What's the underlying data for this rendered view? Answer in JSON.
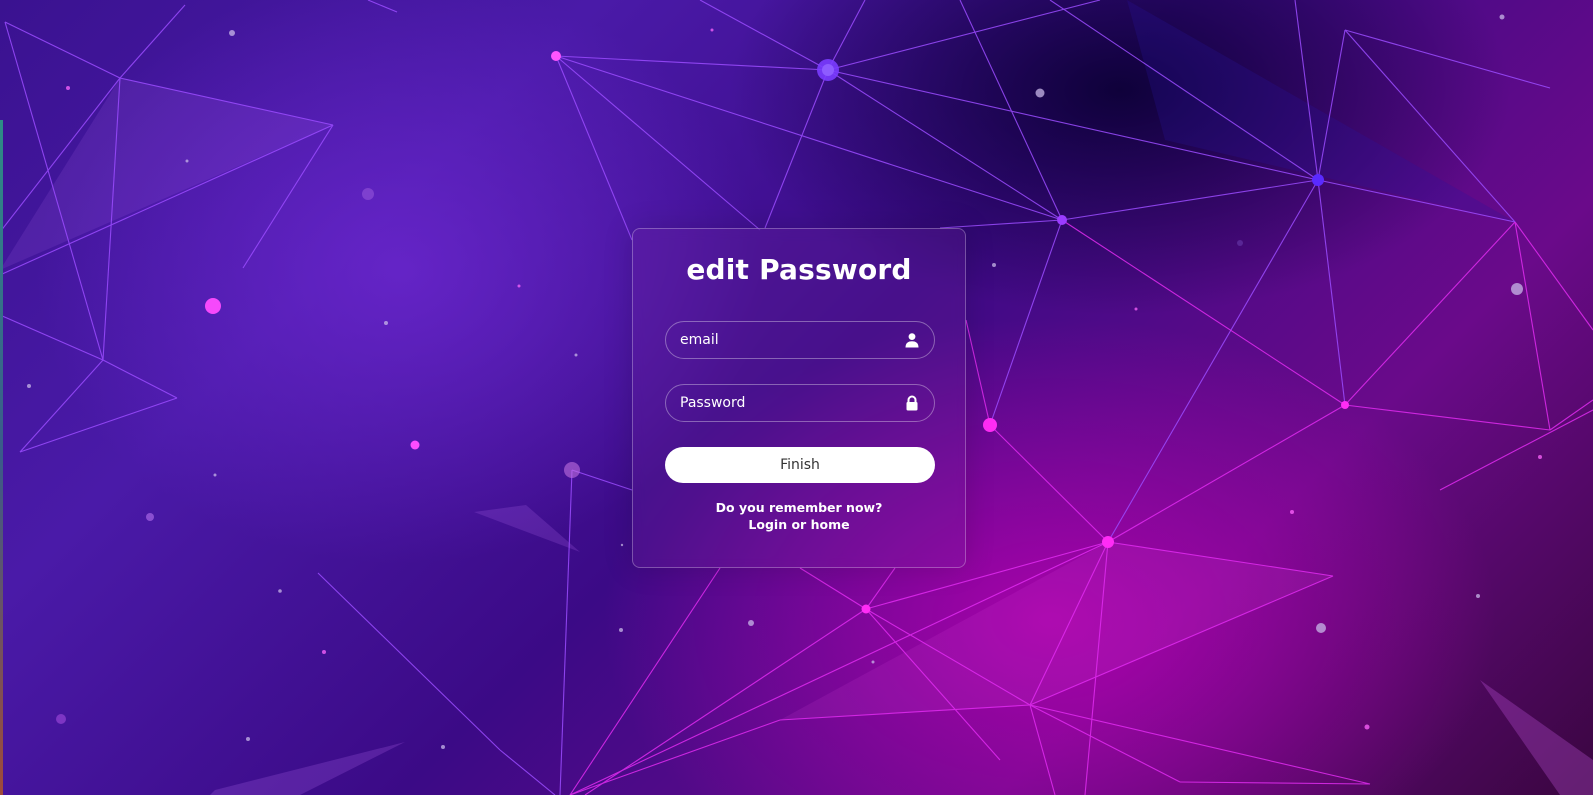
{
  "form": {
    "title": "edit Password",
    "email_placeholder": "email",
    "password_placeholder": "Password",
    "submit_label": "Finish",
    "remember_text": "Do you remember now?",
    "login_link": "Login",
    "or_text": "or",
    "home_link": "home"
  },
  "icons": {
    "email": "user-icon",
    "password": "lock-icon"
  },
  "colors": {
    "button_bg": "#ffffff",
    "text": "#ffffff",
    "accent_magenta": "#e02cf0",
    "accent_violet": "#5a22c8"
  }
}
